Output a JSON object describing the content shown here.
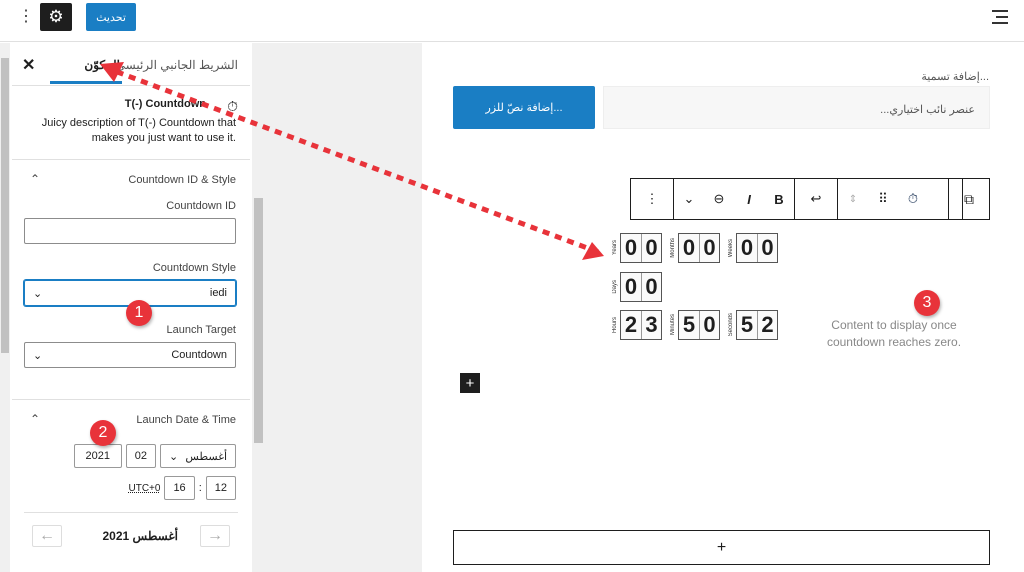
{
  "topbar": {
    "update_label": "تحديث",
    "settings_icon": "gear-icon",
    "more_icon": "kebab-icon",
    "list_view_icon": "list-view-icon"
  },
  "sidebar": {
    "tabs": [
      "الشريط الجانبي الرئيسي",
      "المكوّن"
    ],
    "block": {
      "title": "T(-) Countdown",
      "description": "Juicy description of T(-) Countdown that makes you just want to use it."
    },
    "section1": {
      "title": "Countdown ID & Style",
      "id_label": "Countdown ID",
      "id_value": "",
      "style_label": "Countdown Style",
      "style_value": "iedi",
      "target_label": "Launch Target",
      "target_value": "Countdown"
    },
    "section2": {
      "title": "Launch Date & Time",
      "month": "أغسطس",
      "day": "02",
      "year": "2021",
      "hour": "12",
      "minute": "16",
      "tz": "UTC+0",
      "separator": ":",
      "calendar_title": "أغسطس 2021"
    }
  },
  "canvas": {
    "caption_placeholder": "إضافة تسمية...",
    "input_placeholder": "عنصر نائب اختياري...",
    "button_placeholder": "إضافة نصّ للزر...",
    "countdown": [
      {
        "unit": "Years",
        "value": "00"
      },
      {
        "unit": "Months",
        "value": "00"
      },
      {
        "unit": "Weeks",
        "value": "00"
      },
      {
        "unit": "Days",
        "value": "00"
      },
      {
        "unit": "Hours",
        "value": "23"
      },
      {
        "unit": "Minutes",
        "value": "50"
      },
      {
        "unit": "Seconds",
        "value": "52"
      }
    ],
    "final_content": "Content to display once countdown reaches zero."
  },
  "annotations": {
    "badges": [
      "1",
      "2",
      "3"
    ],
    "color": "#e8333a"
  },
  "colors": {
    "accent": "#1a7ec4"
  }
}
